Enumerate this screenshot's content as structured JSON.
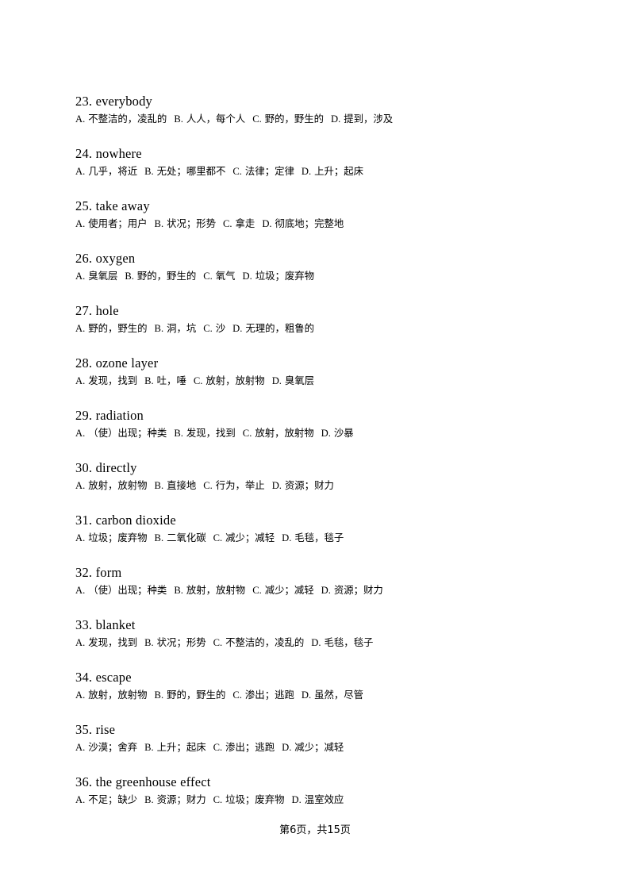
{
  "document": {
    "page_label": "第6页，共15页",
    "text_color": "#000000",
    "background_color": "#ffffff"
  },
  "questions": [
    {
      "number": "23.",
      "headword": "everybody",
      "options": [
        {
          "key": "A.",
          "text": "不整洁的，凌乱的"
        },
        {
          "key": "B.",
          "text": "人人，每个人"
        },
        {
          "key": "C.",
          "text": "野的，野生的"
        },
        {
          "key": "D.",
          "text": "提到，涉及"
        }
      ]
    },
    {
      "number": "24.",
      "headword": "nowhere",
      "options": [
        {
          "key": "A.",
          "text": "几乎，将近"
        },
        {
          "key": "B.",
          "text": "无处；哪里都不"
        },
        {
          "key": "C.",
          "text": "法律；定律"
        },
        {
          "key": "D.",
          "text": "上升；起床"
        }
      ]
    },
    {
      "number": "25.",
      "headword": "take away",
      "options": [
        {
          "key": "A.",
          "text": "使用者；用户"
        },
        {
          "key": "B.",
          "text": "状况；形势"
        },
        {
          "key": "C.",
          "text": "拿走"
        },
        {
          "key": "D.",
          "text": "彻底地；完整地"
        }
      ]
    },
    {
      "number": "26.",
      "headword": "oxygen",
      "options": [
        {
          "key": "A.",
          "text": "臭氧层"
        },
        {
          "key": "B.",
          "text": "野的，野生的"
        },
        {
          "key": "C.",
          "text": "氧气"
        },
        {
          "key": "D.",
          "text": "垃圾；废弃物"
        }
      ]
    },
    {
      "number": "27.",
      "headword": "hole",
      "options": [
        {
          "key": "A.",
          "text": "野的，野生的"
        },
        {
          "key": "B.",
          "text": "洞，坑"
        },
        {
          "key": "C.",
          "text": "沙"
        },
        {
          "key": "D.",
          "text": "无理的，粗鲁的"
        }
      ]
    },
    {
      "number": "28.",
      "headword": "ozone layer",
      "options": [
        {
          "key": "A.",
          "text": "发现，找到"
        },
        {
          "key": "B.",
          "text": "吐，唾"
        },
        {
          "key": "C.",
          "text": "放射，放射物"
        },
        {
          "key": "D.",
          "text": "臭氧层"
        }
      ]
    },
    {
      "number": "29.",
      "headword": "radiation",
      "options": [
        {
          "key": "A.",
          "text": "（使）出现；种类"
        },
        {
          "key": "B.",
          "text": "发现，找到"
        },
        {
          "key": "C.",
          "text": "放射，放射物"
        },
        {
          "key": "D.",
          "text": "沙暴"
        }
      ]
    },
    {
      "number": "30.",
      "headword": "directly",
      "options": [
        {
          "key": "A.",
          "text": "放射，放射物"
        },
        {
          "key": "B.",
          "text": "直接地"
        },
        {
          "key": "C.",
          "text": "行为，举止"
        },
        {
          "key": "D.",
          "text": "资源；财力"
        }
      ]
    },
    {
      "number": "31.",
      "headword": "carbon dioxide",
      "options": [
        {
          "key": "A.",
          "text": "垃圾；废弃物"
        },
        {
          "key": "B.",
          "text": "二氧化碳"
        },
        {
          "key": "C.",
          "text": "减少；减轻"
        },
        {
          "key": "D.",
          "text": "毛毯，毯子"
        }
      ]
    },
    {
      "number": "32.",
      "headword": "form",
      "options": [
        {
          "key": "A.",
          "text": "（使）出现；种类"
        },
        {
          "key": "B.",
          "text": "放射，放射物"
        },
        {
          "key": "C.",
          "text": "减少；减轻"
        },
        {
          "key": "D.",
          "text": "资源；财力"
        }
      ]
    },
    {
      "number": "33.",
      "headword": "blanket",
      "options": [
        {
          "key": "A.",
          "text": "发现，找到"
        },
        {
          "key": "B.",
          "text": "状况；形势"
        },
        {
          "key": "C.",
          "text": "不整洁的，凌乱的"
        },
        {
          "key": "D.",
          "text": "毛毯，毯子"
        }
      ]
    },
    {
      "number": "34.",
      "headword": "escape",
      "options": [
        {
          "key": "A.",
          "text": "放射，放射物"
        },
        {
          "key": "B.",
          "text": "野的，野生的"
        },
        {
          "key": "C.",
          "text": "渗出；逃跑"
        },
        {
          "key": "D.",
          "text": "虽然，尽管"
        }
      ]
    },
    {
      "number": "35.",
      "headword": "rise",
      "options": [
        {
          "key": "A.",
          "text": "沙漠；舍弃"
        },
        {
          "key": "B.",
          "text": "上升；起床"
        },
        {
          "key": "C.",
          "text": "渗出；逃跑"
        },
        {
          "key": "D.",
          "text": "减少；减轻"
        }
      ]
    },
    {
      "number": "36.",
      "headword": "the greenhouse effect",
      "options": [
        {
          "key": "A.",
          "text": "不足；缺少"
        },
        {
          "key": "B.",
          "text": "资源；财力"
        },
        {
          "key": "C.",
          "text": "垃圾；废弃物"
        },
        {
          "key": "D.",
          "text": "温室效应"
        }
      ]
    }
  ]
}
